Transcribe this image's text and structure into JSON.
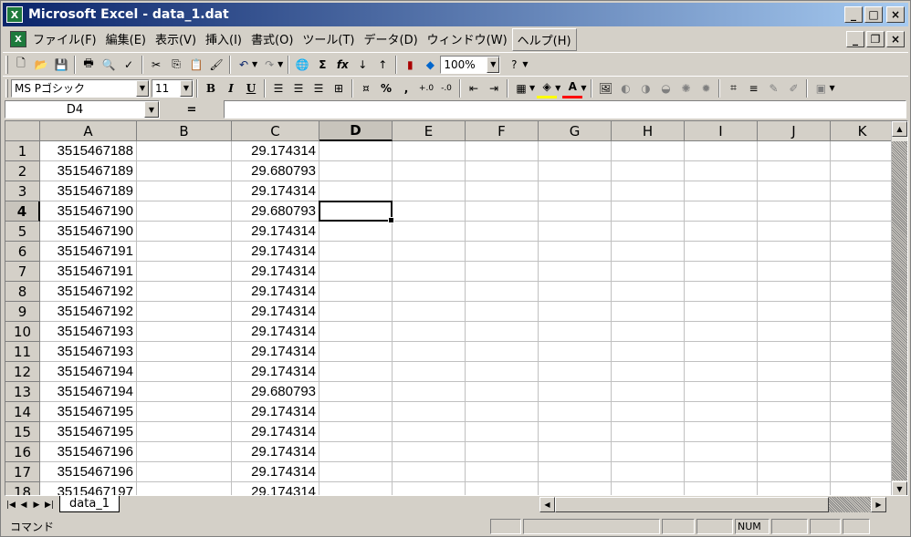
{
  "window": {
    "title": "Microsoft Excel - data_1.dat",
    "app_icon": "excel-icon",
    "minimize": "_",
    "maximize": "□",
    "close": "×",
    "doc_restore": "🗗"
  },
  "menu": {
    "items": [
      "ファイル(F)",
      "編集(E)",
      "表示(V)",
      "挿入(I)",
      "書式(O)",
      "ツール(T)",
      "データ(D)",
      "ウィンドウ(W)",
      "ヘルプ(H)"
    ],
    "active_index": 8
  },
  "toolbar": {
    "zoom": "100%",
    "font_name": "MS Pゴシック",
    "font_size": "11",
    "bold": "B",
    "italic": "I",
    "underline": "U",
    "percent": "%",
    "comma": ",",
    "autosum": "Σ",
    "fx": "fx"
  },
  "formula_bar": {
    "name_box": "D4",
    "equals": "=",
    "value": ""
  },
  "grid": {
    "columns": [
      "A",
      "B",
      "C",
      "D",
      "E",
      "F",
      "G",
      "H",
      "I",
      "J",
      "K"
    ],
    "selected_column": "D",
    "selected_row": 4,
    "rows": [
      {
        "n": "1",
        "a": "3515467188",
        "c": "29.174314"
      },
      {
        "n": "2",
        "a": "3515467189",
        "c": "29.680793"
      },
      {
        "n": "3",
        "a": "3515467189",
        "c": "29.174314"
      },
      {
        "n": "4",
        "a": "3515467190",
        "c": "29.680793"
      },
      {
        "n": "5",
        "a": "3515467190",
        "c": "29.174314"
      },
      {
        "n": "6",
        "a": "3515467191",
        "c": "29.174314"
      },
      {
        "n": "7",
        "a": "3515467191",
        "c": "29.174314"
      },
      {
        "n": "8",
        "a": "3515467192",
        "c": "29.174314"
      },
      {
        "n": "9",
        "a": "3515467192",
        "c": "29.174314"
      },
      {
        "n": "10",
        "a": "3515467193",
        "c": "29.174314"
      },
      {
        "n": "11",
        "a": "3515467193",
        "c": "29.174314"
      },
      {
        "n": "12",
        "a": "3515467194",
        "c": "29.174314"
      },
      {
        "n": "13",
        "a": "3515467194",
        "c": "29.680793"
      },
      {
        "n": "14",
        "a": "3515467195",
        "c": "29.174314"
      },
      {
        "n": "15",
        "a": "3515467195",
        "c": "29.174314"
      },
      {
        "n": "16",
        "a": "3515467196",
        "c": "29.174314"
      },
      {
        "n": "17",
        "a": "3515467196",
        "c": "29.174314"
      },
      {
        "n": "18",
        "a": "3515467197",
        "c": "29.174314"
      }
    ]
  },
  "sheet_tabs": [
    "data_1"
  ],
  "status": {
    "mode": "コマンド",
    "num": "NUM"
  }
}
